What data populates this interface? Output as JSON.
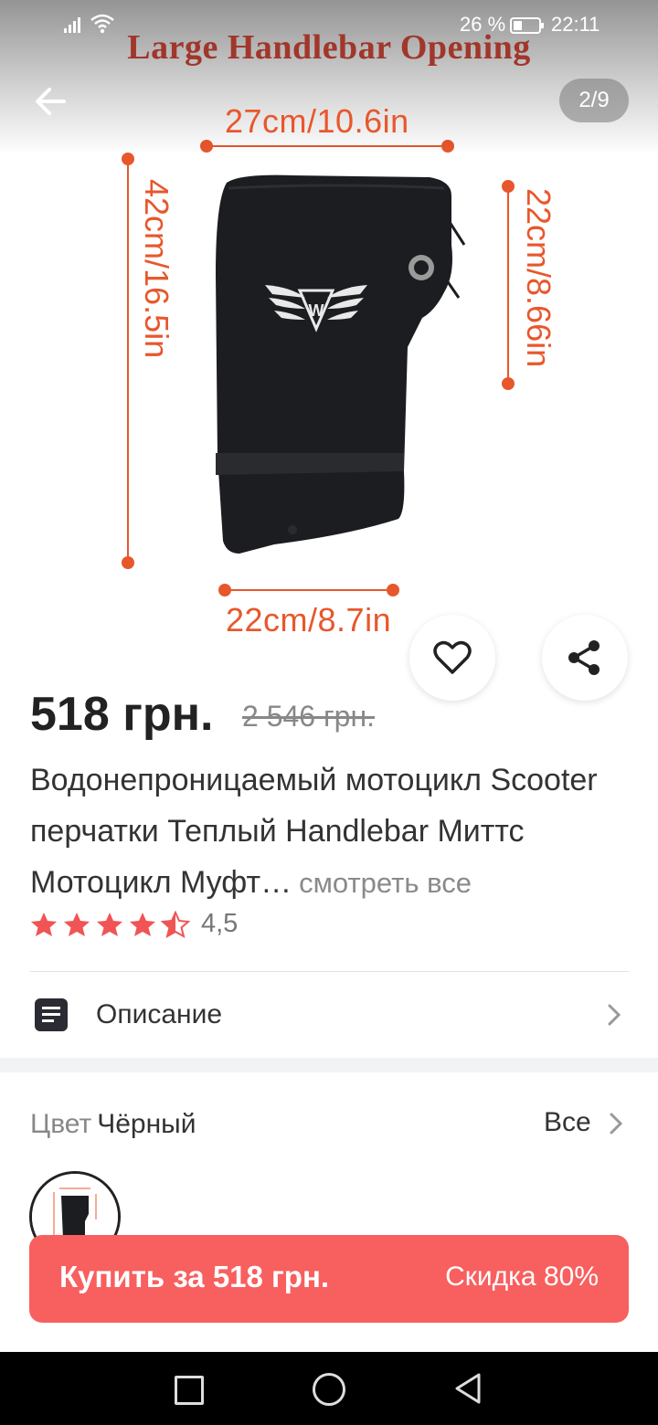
{
  "status_bar": {
    "battery_percent": "26 %",
    "time": "22:11"
  },
  "gallery": {
    "image_caption": "Large Handlebar Opening",
    "counter": "2/9",
    "dimensions": {
      "top": "27cm/10.6in",
      "left": "42cm/16.5in",
      "right": "22cm/8.66in",
      "bottom": "22cm/8.7in"
    }
  },
  "product": {
    "price": "518 грн.",
    "old_price": "2 546 грн.",
    "title": "Водонепроницаемый мотоцикл Scooter перчатки Теплый Handlebar Миттс Мотоцикл Муфт…",
    "see_all": "смотреть все",
    "rating": "4,5",
    "rating_value": 4.5,
    "star_color": "#f05454"
  },
  "description": {
    "label": "Описание"
  },
  "color_option": {
    "label": "Цвет",
    "value": "Чёрный",
    "all": "Все"
  },
  "buy_button": {
    "label": "Купить за 518 грн.",
    "discount": "Скидка 80%",
    "color": "#f85f5f"
  }
}
